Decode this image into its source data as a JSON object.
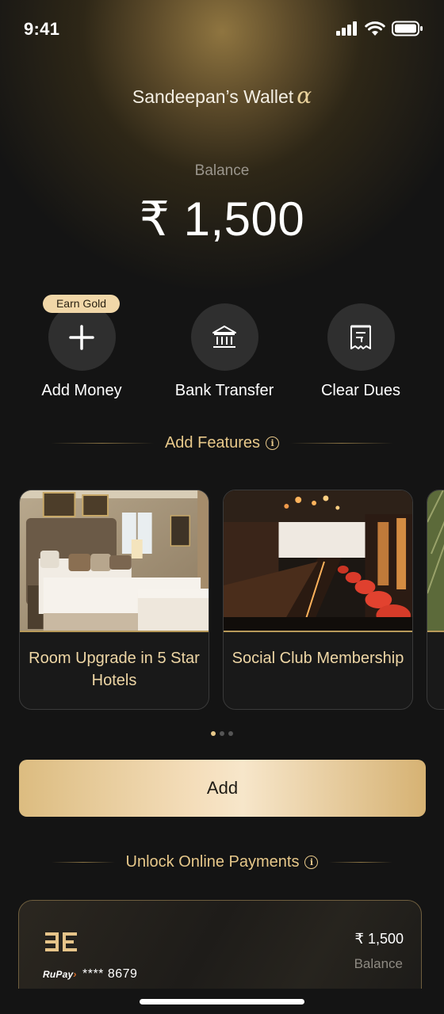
{
  "status_bar": {
    "time": "9:41"
  },
  "header": {
    "title": "Sandeepan’s Wallet"
  },
  "balance": {
    "label": "Balance",
    "amount": "₹ 1,500"
  },
  "actions": {
    "earn_badge": "Earn Gold",
    "items": [
      {
        "label": "Add Money",
        "icon": "plus-icon"
      },
      {
        "label": "Bank Transfer",
        "icon": "bank-icon"
      },
      {
        "label": "Clear Dues",
        "icon": "receipt-icon"
      }
    ]
  },
  "features_section": {
    "title": "Add Features"
  },
  "feature_cards": [
    {
      "label": "Room Upgrade in 5 Star Hotels",
      "image": "hotel-room"
    },
    {
      "label": "Social Club Membership",
      "image": "club-bar"
    }
  ],
  "carousel": {
    "page_count": 3,
    "active_index": 0
  },
  "add_button": {
    "label": "Add"
  },
  "payments_section": {
    "title": "Unlock Online Payments"
  },
  "card": {
    "network": "RuPay",
    "masked_number": "**** 8679",
    "amount": "₹ 1,500",
    "balance_label": "Balance"
  },
  "colors": {
    "accent_gold": "#e7c88a",
    "background": "#141414",
    "button_gold": "#f5dfbd"
  }
}
